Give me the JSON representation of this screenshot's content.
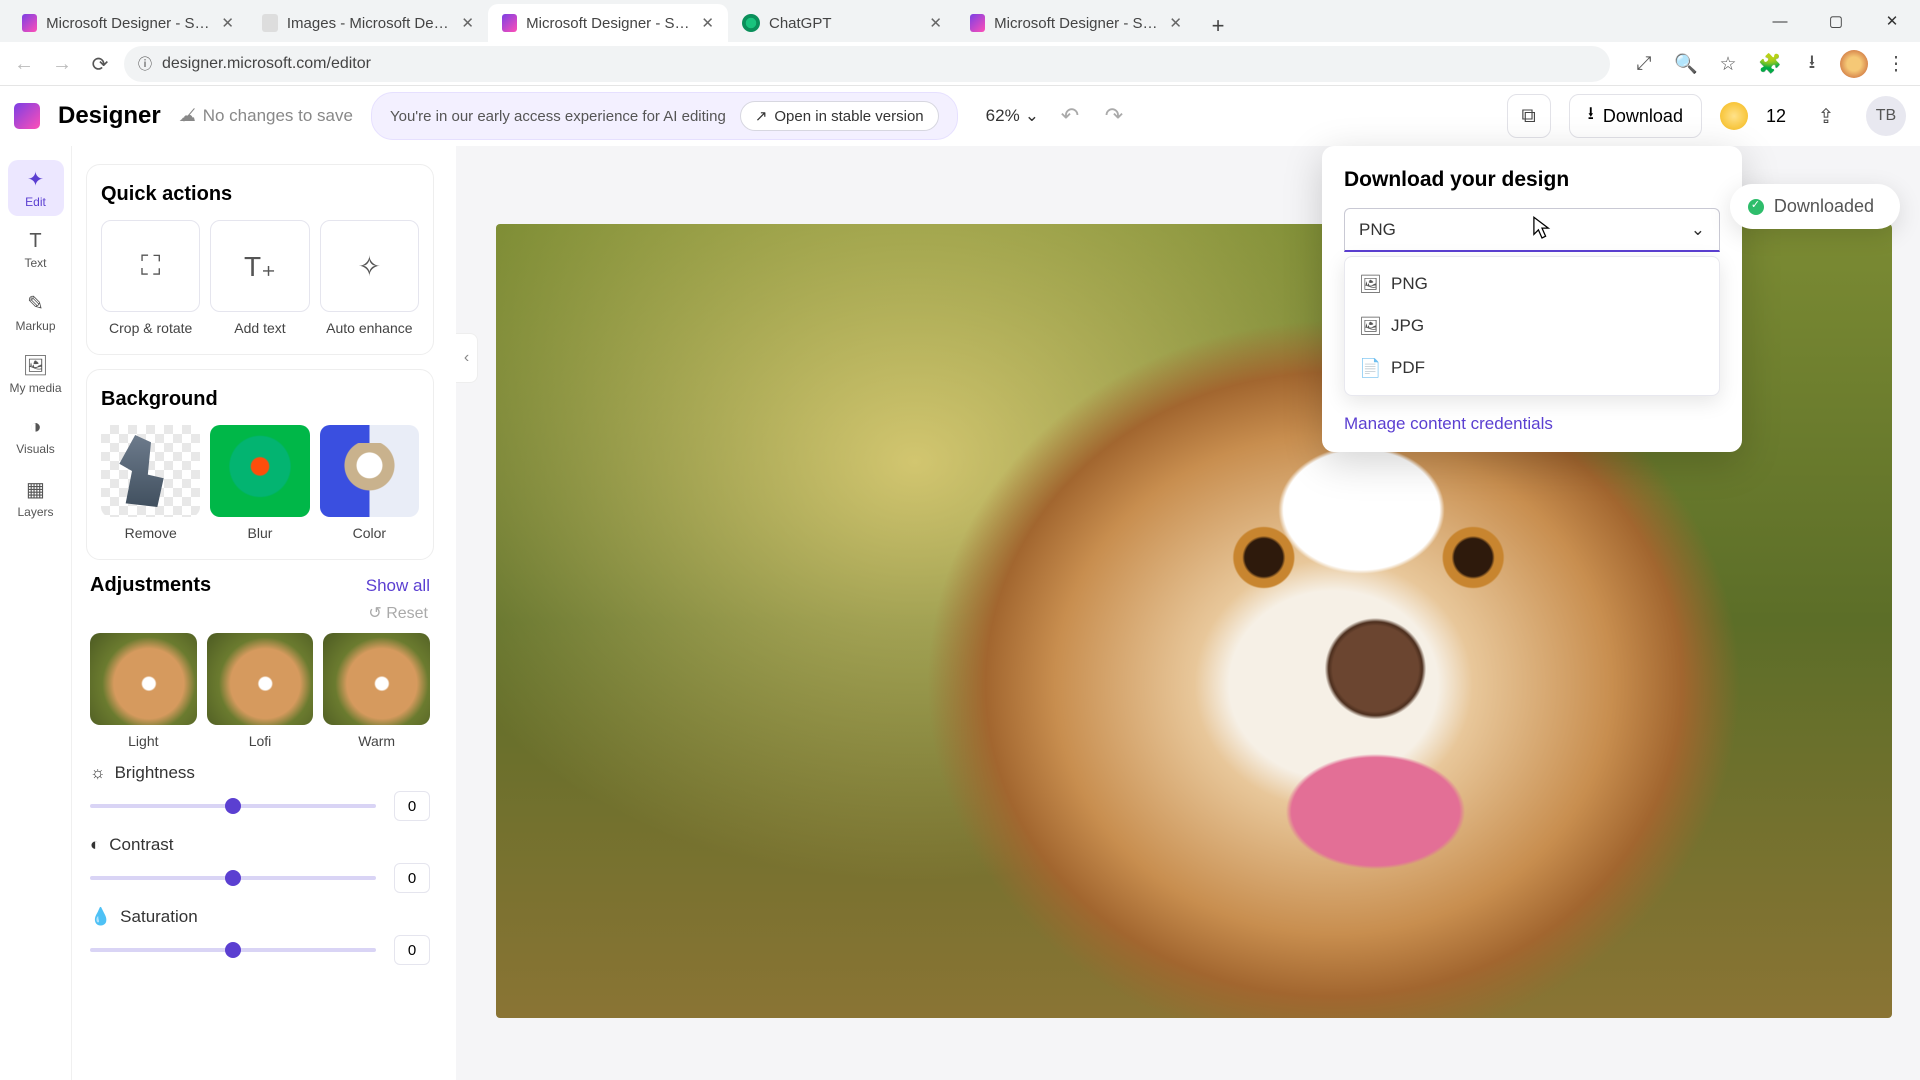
{
  "browser": {
    "tabs": [
      {
        "label": "Microsoft Designer - Stunning",
        "fav": "designer"
      },
      {
        "label": "Images - Microsoft Designer",
        "fav": "images"
      },
      {
        "label": "Microsoft Designer - Stunning",
        "fav": "designer"
      },
      {
        "label": "ChatGPT",
        "fav": "chatgpt"
      },
      {
        "label": "Microsoft Designer - Stunning",
        "fav": "designer"
      }
    ],
    "active_tab_index": 2,
    "url": "designer.microsoft.com/editor"
  },
  "header": {
    "brand": "Designer",
    "save_status": "No changes to save",
    "banner_text": "You're in our early access experience for AI editing",
    "stable_btn": "Open in stable version",
    "zoom": "62%",
    "download_label": "Download",
    "credits": "12",
    "avatar_initials": "TB"
  },
  "rail": {
    "items": [
      {
        "id": "edit",
        "label": "Edit",
        "glyph": "✦"
      },
      {
        "id": "text",
        "label": "Text",
        "glyph": "T"
      },
      {
        "id": "markup",
        "label": "Markup",
        "glyph": "✎"
      },
      {
        "id": "mymedia",
        "label": "My media",
        "glyph": "🖼"
      },
      {
        "id": "visuals",
        "label": "Visuals",
        "glyph": "◑"
      },
      {
        "id": "layers",
        "label": "Layers",
        "glyph": "▦"
      }
    ],
    "active_index": 0
  },
  "panel": {
    "quick_actions": {
      "title": "Quick actions",
      "items": [
        {
          "label": "Crop & rotate",
          "glyph": "⛶"
        },
        {
          "label": "Add text",
          "glyph": "T₊"
        },
        {
          "label": "Auto enhance",
          "glyph": "✧"
        }
      ]
    },
    "background": {
      "title": "Background",
      "items": [
        {
          "label": "Remove",
          "kind": "remove"
        },
        {
          "label": "Blur",
          "kind": "blur"
        },
        {
          "label": "Color",
          "kind": "color"
        }
      ]
    },
    "adjustments": {
      "title": "Adjustments",
      "show_all": "Show all",
      "reset": "Reset",
      "presets": [
        {
          "label": "Light"
        },
        {
          "label": "Lofi"
        },
        {
          "label": "Warm"
        }
      ],
      "sliders": [
        {
          "label": "Brightness",
          "glyph": "☼",
          "value": "0",
          "pct": 50
        },
        {
          "label": "Contrast",
          "glyph": "◐",
          "value": "0",
          "pct": 50
        },
        {
          "label": "Saturation",
          "glyph": "💧",
          "value": "0",
          "pct": 50
        }
      ]
    }
  },
  "popover": {
    "title": "Download your design",
    "selected": "PNG",
    "options": [
      {
        "label": "PNG",
        "glyph": "🖼"
      },
      {
        "label": "JPG",
        "glyph": "🖼"
      },
      {
        "label": "PDF",
        "glyph": "📄"
      }
    ],
    "credentials_link": "Manage content credentials"
  },
  "toast": {
    "text": "Downloaded"
  }
}
